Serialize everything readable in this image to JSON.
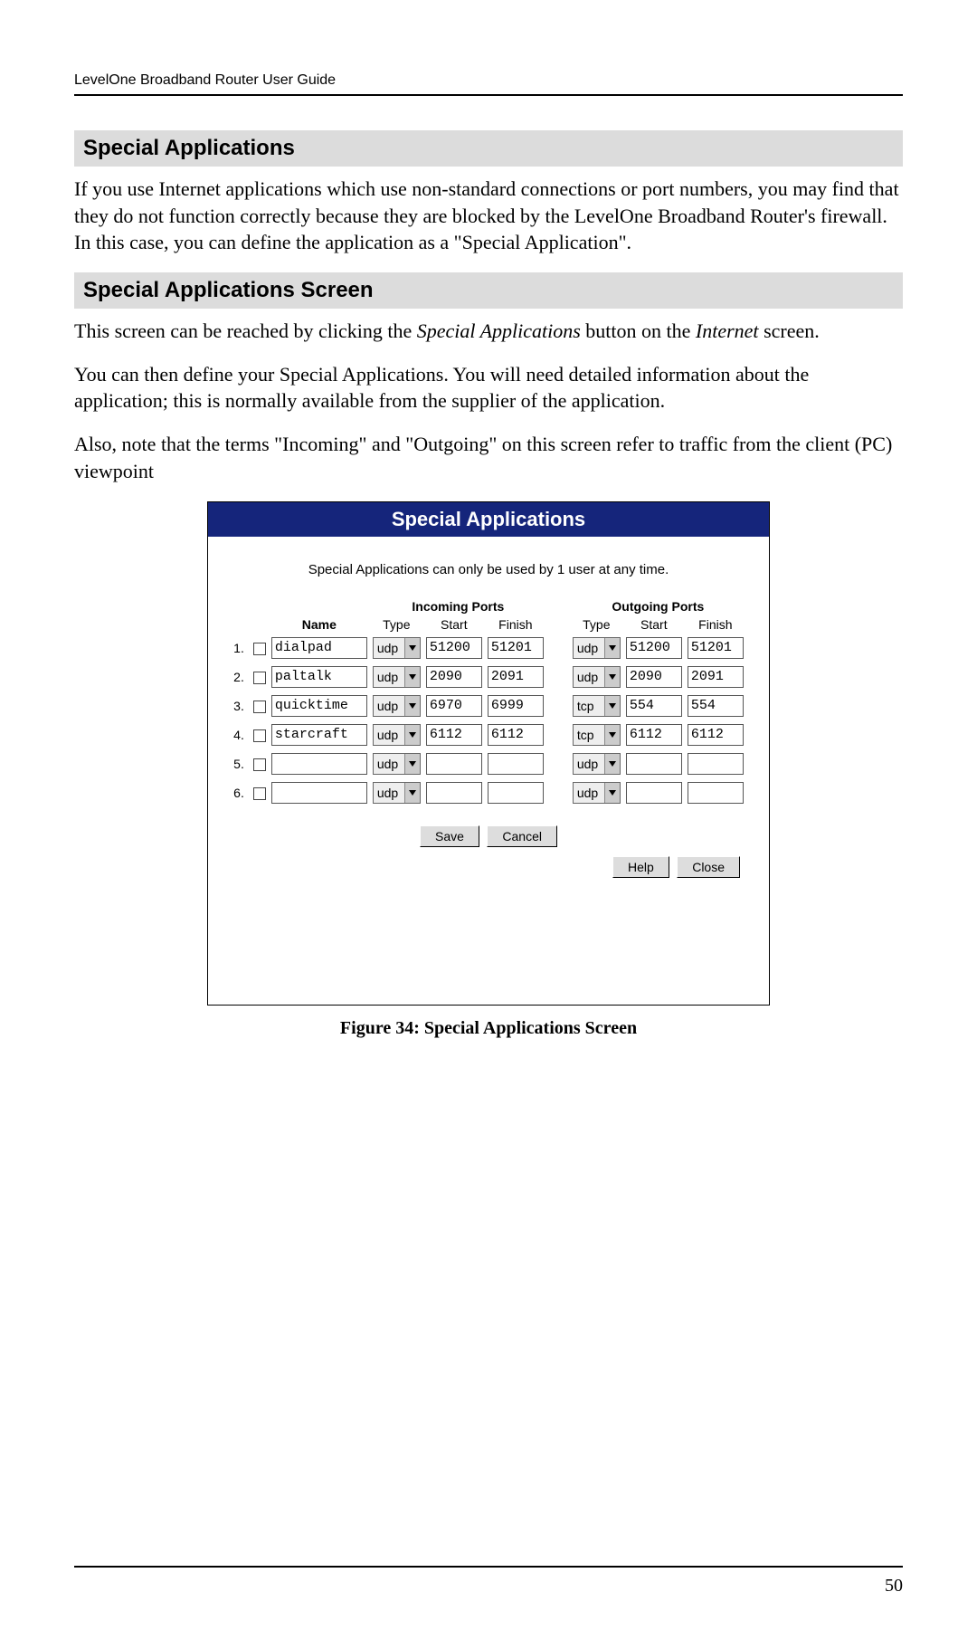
{
  "header": "LevelOne Broadband Router User Guide",
  "sections": {
    "s1_title": "Special Applications",
    "s1_body": "If you use Internet applications which use non-standard connections or port numbers, you may find that they do not function correctly because they are blocked by the LevelOne Broadband Router's firewall. In this case, you can define the application as a \"Special Application\".",
    "s2_title": "Special Applications Screen",
    "s2_p1_a": "This screen can be reached by clicking the ",
    "s2_p1_b": "Special Applications",
    "s2_p1_c": " button on the ",
    "s2_p1_d": "Internet",
    "s2_p1_e": " screen.",
    "s2_p2": "You can then define your Special Applications. You will need detailed information about the application; this is normally available from the supplier of the application.",
    "s2_p3": "Also, note that the terms \"Incoming\" and \"Outgoing\" on this screen refer to traffic from the client (PC) viewpoint"
  },
  "figure": {
    "banner": "Special Applications",
    "note": "Special Applications can only be used by 1 user at any time.",
    "headers": {
      "name": "Name",
      "incoming": "Incoming Ports",
      "outgoing": "Outgoing Ports",
      "type": "Type",
      "start": "Start",
      "finish": "Finish"
    },
    "rows": [
      {
        "num": "1.",
        "name": "dialpad",
        "in_type": "udp",
        "in_start": "51200",
        "in_finish": "51201",
        "out_type": "udp",
        "out_start": "51200",
        "out_finish": "51201"
      },
      {
        "num": "2.",
        "name": "paltalk",
        "in_type": "udp",
        "in_start": "2090",
        "in_finish": "2091",
        "out_type": "udp",
        "out_start": "2090",
        "out_finish": "2091"
      },
      {
        "num": "3.",
        "name": "quicktime",
        "in_type": "udp",
        "in_start": "6970",
        "in_finish": "6999",
        "out_type": "tcp",
        "out_start": "554",
        "out_finish": "554"
      },
      {
        "num": "4.",
        "name": "starcraft",
        "in_type": "udp",
        "in_start": "6112",
        "in_finish": "6112",
        "out_type": "tcp",
        "out_start": "6112",
        "out_finish": "6112"
      },
      {
        "num": "5.",
        "name": "",
        "in_type": "udp",
        "in_start": "",
        "in_finish": "",
        "out_type": "udp",
        "out_start": "",
        "out_finish": ""
      },
      {
        "num": "6.",
        "name": "",
        "in_type": "udp",
        "in_start": "",
        "in_finish": "",
        "out_type": "udp",
        "out_start": "",
        "out_finish": ""
      }
    ],
    "buttons": {
      "save": "Save",
      "cancel": "Cancel",
      "help": "Help",
      "close": "Close"
    },
    "caption": "Figure 34: Special Applications Screen"
  },
  "page_number": "50"
}
